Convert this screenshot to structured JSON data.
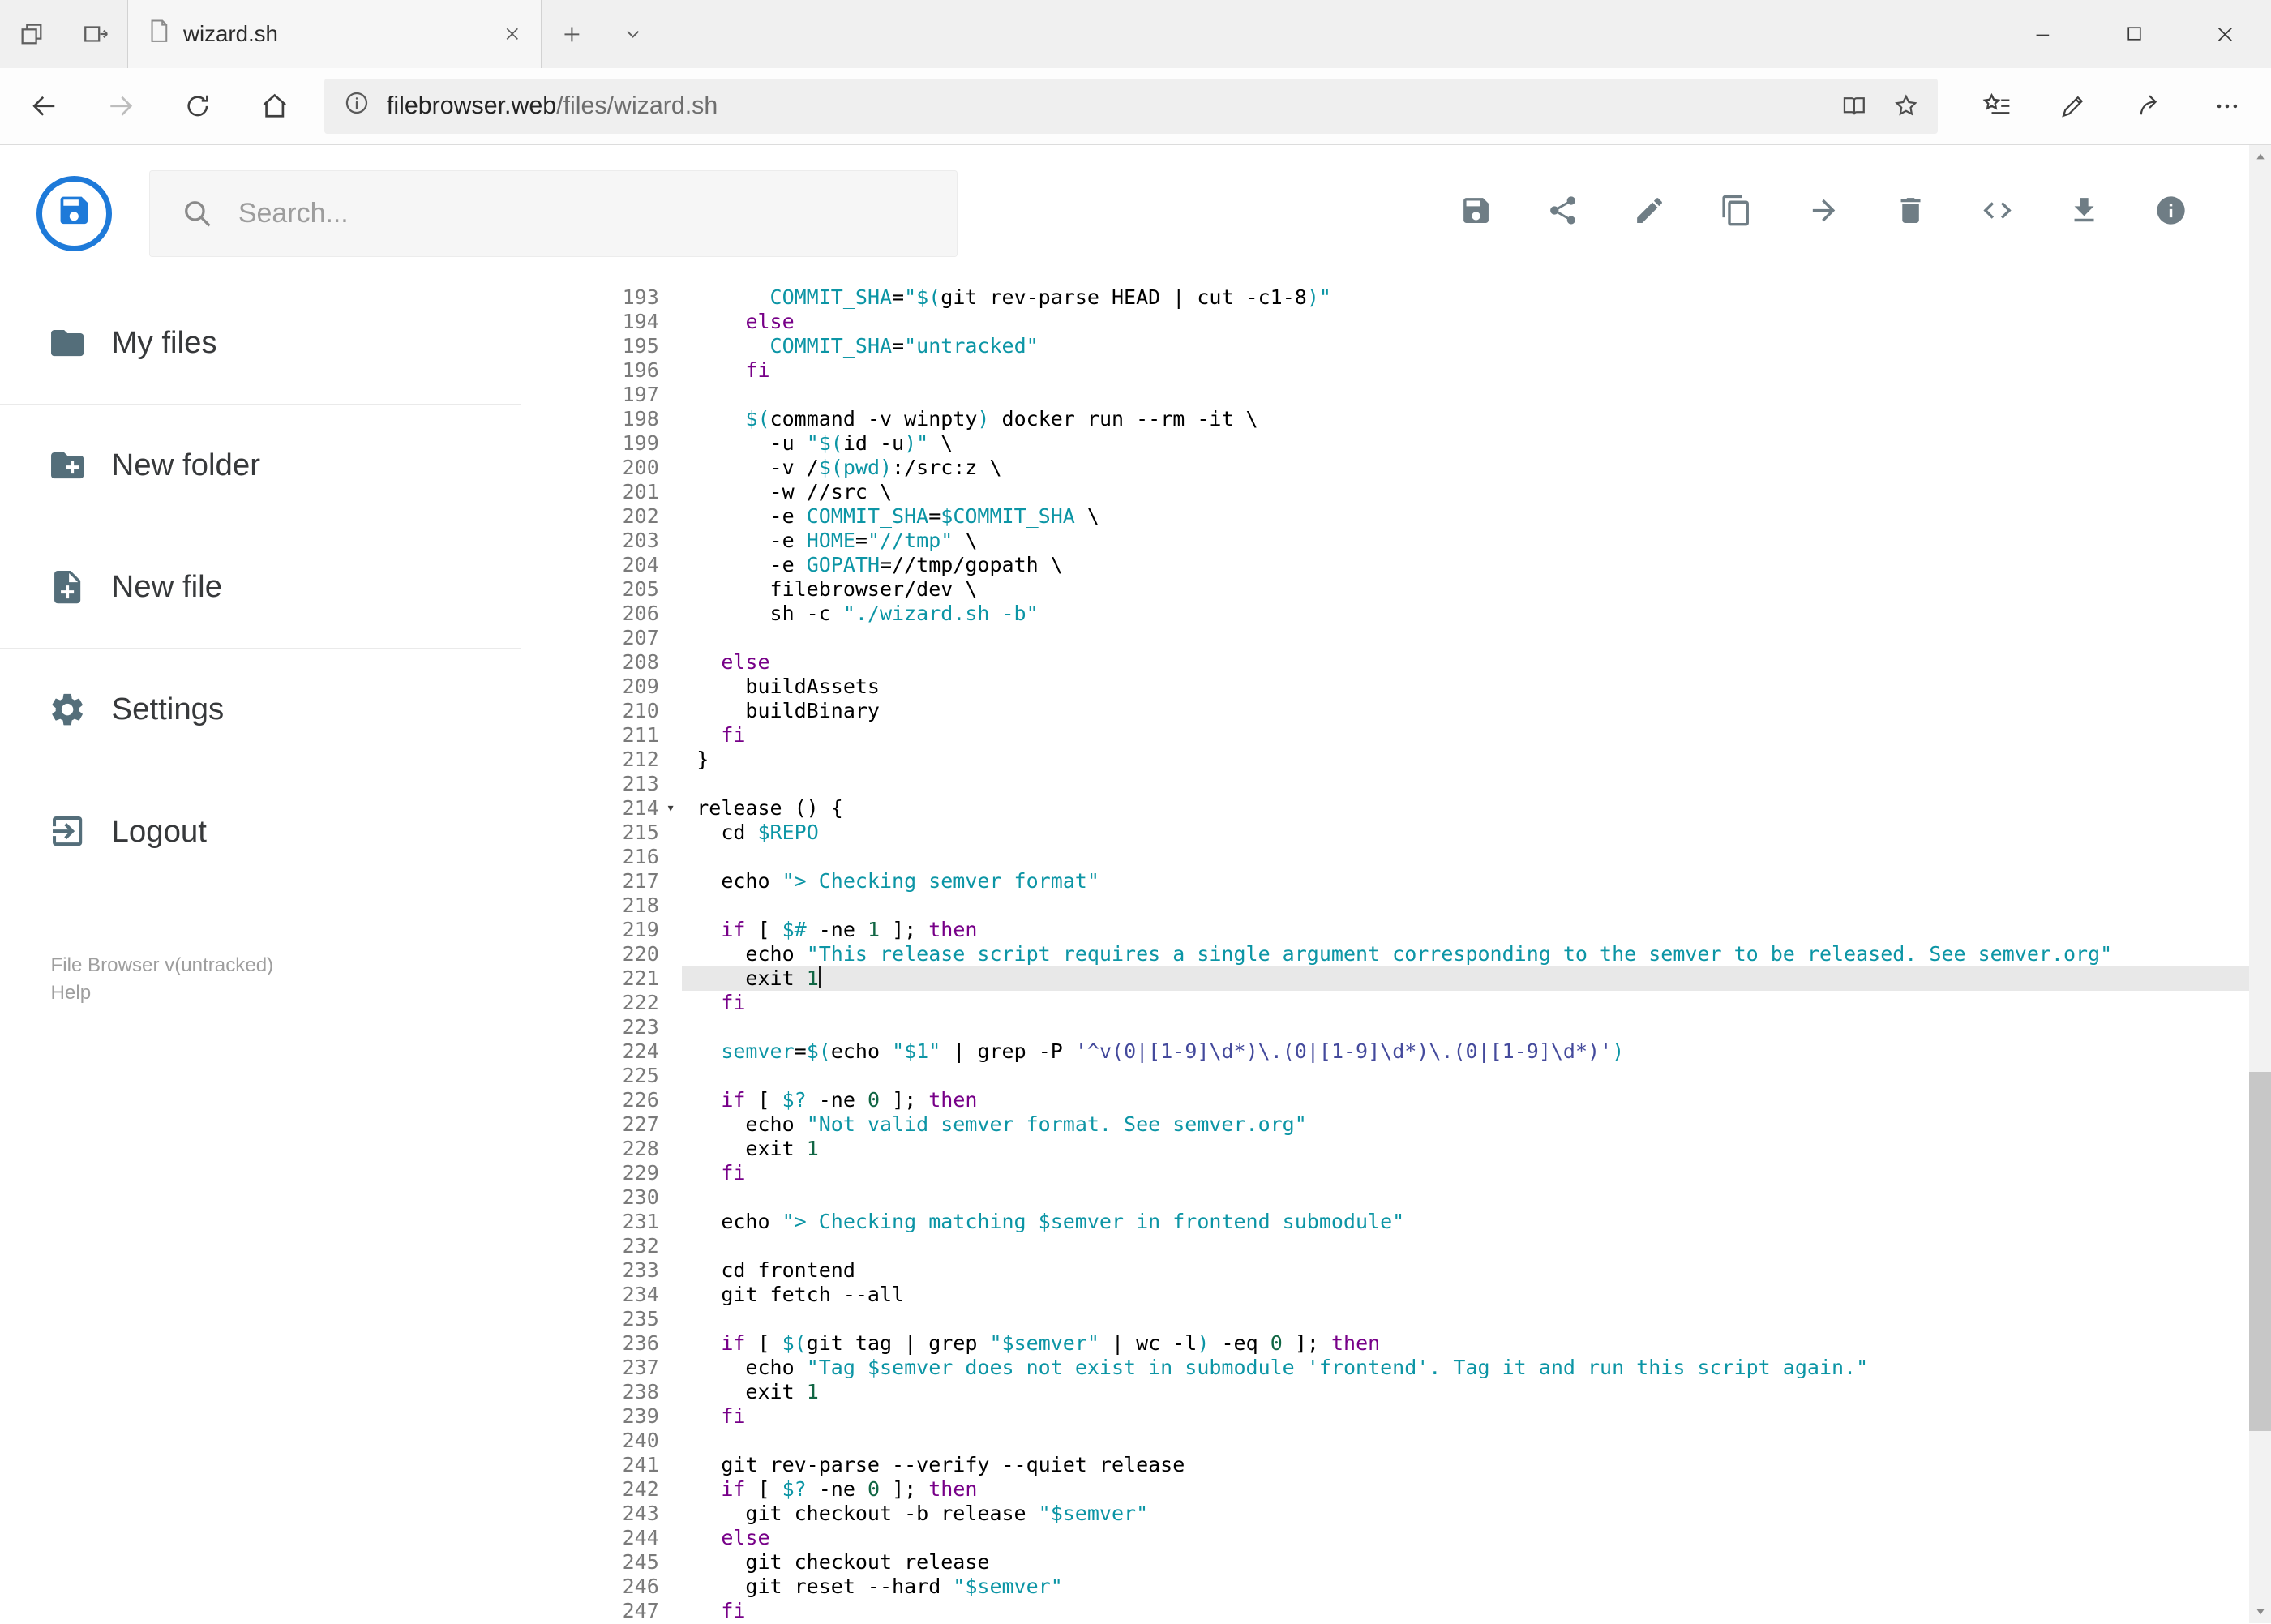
{
  "colors": {
    "accent": "#1e7ad9",
    "iconGray": "#6f7d85",
    "sidebarIcon": "#546e7a",
    "keyword": "#770088",
    "string": "#0c95a5",
    "string2": "#444a9c",
    "variable": "#0c95a5",
    "definition": "#0c95a5",
    "number": "#116644",
    "codeText": "#000000",
    "activeLine": "#e8e8e8",
    "lineNumber": "#7a7a7a"
  },
  "browser": {
    "tab_title": "wizard.sh",
    "url_host": "filebrowser.web",
    "url_path": "/files/wizard.sh",
    "icons": [
      "set-tabs-aside-icon",
      "tabs-set-aside-icon",
      "page-icon",
      "tab-close-icon",
      "new-tab-icon",
      "tab-preview-chevron-icon",
      "minimize-icon",
      "maximize-icon",
      "close-icon",
      "back-icon",
      "forward-icon",
      "refresh-icon",
      "home-icon",
      "site-info-icon",
      "reading-view-icon",
      "favorite-star-icon",
      "hub-icon",
      "web-note-pen-icon",
      "share-icon",
      "ellipsis-icon"
    ]
  },
  "header": {
    "search_placeholder": "Search...",
    "logo_icon": "logo-floppy-icon",
    "search_icon": "search-icon",
    "toolbar": [
      {
        "icon": "save-icon"
      },
      {
        "icon": "share-icon"
      },
      {
        "icon": "edit-icon"
      },
      {
        "icon": "copy-icon"
      },
      {
        "icon": "move-icon"
      },
      {
        "icon": "delete-icon"
      },
      {
        "icon": "code-icon"
      },
      {
        "icon": "download-icon"
      },
      {
        "icon": "info-icon"
      }
    ]
  },
  "sidebar": {
    "items": [
      {
        "icon": "folder-icon",
        "label": "My files",
        "divider_after": true
      },
      {
        "icon": "new-folder-icon",
        "label": "New folder"
      },
      {
        "icon": "new-file-icon",
        "label": "New file",
        "divider_after": true
      },
      {
        "icon": "settings-icon",
        "label": "Settings"
      },
      {
        "icon": "logout-icon",
        "label": "Logout"
      }
    ],
    "footer_version": "File Browser v(untracked)",
    "footer_help": "Help"
  },
  "editor": {
    "active_line": 221,
    "cursor_line": 221,
    "fold_lines": [
      214
    ],
    "fold_glyph": "▾",
    "lines": [
      {
        "n": 193,
        "t": [
          [
            "t",
            "      "
          ],
          [
            "d",
            "COMMIT_SHA"
          ],
          [
            "t",
            "="
          ],
          [
            "s",
            "\"$("
          ],
          [
            "t",
            "git rev-parse HEAD | cut -c1-8"
          ],
          [
            "s",
            ")\""
          ]
        ]
      },
      {
        "n": 194,
        "t": [
          [
            "t",
            "    "
          ],
          [
            "k",
            "else"
          ]
        ]
      },
      {
        "n": 195,
        "t": [
          [
            "t",
            "      "
          ],
          [
            "d",
            "COMMIT_SHA"
          ],
          [
            "t",
            "="
          ],
          [
            "s",
            "\"untracked\""
          ]
        ]
      },
      {
        "n": 196,
        "t": [
          [
            "t",
            "    "
          ],
          [
            "k",
            "fi"
          ]
        ]
      },
      {
        "n": 197,
        "t": []
      },
      {
        "n": 198,
        "t": [
          [
            "t",
            "    "
          ],
          [
            "v",
            "$("
          ],
          [
            "t",
            "command -v winpty"
          ],
          [
            "v",
            ")"
          ],
          [
            "t",
            " docker run --rm -it \\"
          ]
        ]
      },
      {
        "n": 199,
        "t": [
          [
            "t",
            "      -u "
          ],
          [
            "s",
            "\"$("
          ],
          [
            "t",
            "id -u"
          ],
          [
            "s",
            ")\""
          ],
          [
            "t",
            " \\"
          ]
        ]
      },
      {
        "n": 200,
        "t": [
          [
            "t",
            "      -v /"
          ],
          [
            "v",
            "$(pwd)"
          ],
          [
            "t",
            ":/src:z \\"
          ]
        ]
      },
      {
        "n": 201,
        "t": [
          [
            "t",
            "      -w //src \\"
          ]
        ]
      },
      {
        "n": 202,
        "t": [
          [
            "t",
            "      -e "
          ],
          [
            "d",
            "COMMIT_SHA"
          ],
          [
            "t",
            "="
          ],
          [
            "v",
            "$COMMIT_SHA"
          ],
          [
            "t",
            " \\"
          ]
        ]
      },
      {
        "n": 203,
        "t": [
          [
            "t",
            "      -e "
          ],
          [
            "d",
            "HOME"
          ],
          [
            "t",
            "="
          ],
          [
            "s",
            "\"//tmp\""
          ],
          [
            "t",
            " \\"
          ]
        ]
      },
      {
        "n": 204,
        "t": [
          [
            "t",
            "      -e "
          ],
          [
            "d",
            "GOPATH"
          ],
          [
            "t",
            "=//tmp/gopath \\"
          ]
        ]
      },
      {
        "n": 205,
        "t": [
          [
            "t",
            "      filebrowser/dev \\"
          ]
        ]
      },
      {
        "n": 206,
        "t": [
          [
            "t",
            "      sh -c "
          ],
          [
            "s",
            "\"./wizard.sh -b\""
          ]
        ]
      },
      {
        "n": 207,
        "t": []
      },
      {
        "n": 208,
        "t": [
          [
            "t",
            "  "
          ],
          [
            "k",
            "else"
          ]
        ]
      },
      {
        "n": 209,
        "t": [
          [
            "t",
            "    buildAssets"
          ]
        ]
      },
      {
        "n": 210,
        "t": [
          [
            "t",
            "    buildBinary"
          ]
        ]
      },
      {
        "n": 211,
        "t": [
          [
            "t",
            "  "
          ],
          [
            "k",
            "fi"
          ]
        ]
      },
      {
        "n": 212,
        "t": [
          [
            "t",
            "}"
          ]
        ]
      },
      {
        "n": 213,
        "t": []
      },
      {
        "n": 214,
        "t": [
          [
            "t",
            "release () {"
          ]
        ]
      },
      {
        "n": 215,
        "t": [
          [
            "t",
            "  cd "
          ],
          [
            "v",
            "$REPO"
          ]
        ]
      },
      {
        "n": 216,
        "t": []
      },
      {
        "n": 217,
        "t": [
          [
            "t",
            "  echo "
          ],
          [
            "s",
            "\"> Checking semver format\""
          ]
        ]
      },
      {
        "n": 218,
        "t": []
      },
      {
        "n": 219,
        "t": [
          [
            "t",
            "  "
          ],
          [
            "k",
            "if"
          ],
          [
            "t",
            " [ "
          ],
          [
            "v",
            "$#"
          ],
          [
            "t",
            " -ne "
          ],
          [
            "n2",
            ""
          ],
          [
            "n",
            "1"
          ],
          [
            "t",
            " ]; "
          ],
          [
            "k",
            "then"
          ]
        ]
      },
      {
        "n": 220,
        "t": [
          [
            "t",
            "    echo "
          ],
          [
            "s",
            "\"This release script requires a single argument corresponding to the semver to be released. See semver.org\""
          ]
        ]
      },
      {
        "n": 221,
        "t": [
          [
            "t",
            "    exit "
          ],
          [
            "n",
            "1"
          ]
        ]
      },
      {
        "n": 222,
        "t": [
          [
            "t",
            "  "
          ],
          [
            "k",
            "fi"
          ]
        ]
      },
      {
        "n": 223,
        "t": []
      },
      {
        "n": 224,
        "t": [
          [
            "t",
            "  "
          ],
          [
            "d",
            "semver"
          ],
          [
            "t",
            "="
          ],
          [
            "v",
            "$("
          ],
          [
            "t",
            "echo "
          ],
          [
            "s",
            "\"$1\""
          ],
          [
            "t",
            " | grep -P "
          ],
          [
            "s2",
            "'^v(0|[1-9]\\d*)\\.(0|[1-9]\\d*)\\.(0|[1-9]\\d*)'"
          ],
          [
            "v",
            ")"
          ]
        ]
      },
      {
        "n": 225,
        "t": []
      },
      {
        "n": 226,
        "t": [
          [
            "t",
            "  "
          ],
          [
            "k",
            "if"
          ],
          [
            "t",
            " [ "
          ],
          [
            "v",
            "$?"
          ],
          [
            "t",
            " -ne "
          ],
          [
            "n",
            "0"
          ],
          [
            "t",
            " ]; "
          ],
          [
            "k",
            "then"
          ]
        ]
      },
      {
        "n": 227,
        "t": [
          [
            "t",
            "    echo "
          ],
          [
            "s",
            "\"Not valid semver format. See semver.org\""
          ]
        ]
      },
      {
        "n": 228,
        "t": [
          [
            "t",
            "    exit "
          ],
          [
            "n",
            "1"
          ]
        ]
      },
      {
        "n": 229,
        "t": [
          [
            "t",
            "  "
          ],
          [
            "k",
            "fi"
          ]
        ]
      },
      {
        "n": 230,
        "t": []
      },
      {
        "n": 231,
        "t": [
          [
            "t",
            "  echo "
          ],
          [
            "s",
            "\"> Checking matching $semver in frontend submodule\""
          ]
        ]
      },
      {
        "n": 232,
        "t": []
      },
      {
        "n": 233,
        "t": [
          [
            "t",
            "  cd frontend"
          ]
        ]
      },
      {
        "n": 234,
        "t": [
          [
            "t",
            "  git fetch --all"
          ]
        ]
      },
      {
        "n": 235,
        "t": []
      },
      {
        "n": 236,
        "t": [
          [
            "t",
            "  "
          ],
          [
            "k",
            "if"
          ],
          [
            "t",
            " [ "
          ],
          [
            "v",
            "$("
          ],
          [
            "t",
            "git tag | grep "
          ],
          [
            "s",
            "\"$semver\""
          ],
          [
            "t",
            " | wc -l"
          ],
          [
            "v",
            ")"
          ],
          [
            "t",
            " -eq "
          ],
          [
            "n",
            "0"
          ],
          [
            "t",
            " ]; "
          ],
          [
            "k",
            "then"
          ]
        ]
      },
      {
        "n": 237,
        "t": [
          [
            "t",
            "    echo "
          ],
          [
            "s",
            "\"Tag $semver does not exist in submodule 'frontend'. Tag it and run this script again.\""
          ]
        ]
      },
      {
        "n": 238,
        "t": [
          [
            "t",
            "    exit "
          ],
          [
            "n",
            "1"
          ]
        ]
      },
      {
        "n": 239,
        "t": [
          [
            "t",
            "  "
          ],
          [
            "k",
            "fi"
          ]
        ]
      },
      {
        "n": 240,
        "t": []
      },
      {
        "n": 241,
        "t": [
          [
            "t",
            "  git rev-parse --verify --quiet release"
          ]
        ]
      },
      {
        "n": 242,
        "t": [
          [
            "t",
            "  "
          ],
          [
            "k",
            "if"
          ],
          [
            "t",
            " [ "
          ],
          [
            "v",
            "$?"
          ],
          [
            "t",
            " -ne "
          ],
          [
            "n",
            "0"
          ],
          [
            "t",
            " ]; "
          ],
          [
            "k",
            "then"
          ]
        ]
      },
      {
        "n": 243,
        "t": [
          [
            "t",
            "    git checkout -b release "
          ],
          [
            "s",
            "\"$semver\""
          ]
        ]
      },
      {
        "n": 244,
        "t": [
          [
            "t",
            "  "
          ],
          [
            "k",
            "else"
          ]
        ]
      },
      {
        "n": 245,
        "t": [
          [
            "t",
            "    git checkout release"
          ]
        ]
      },
      {
        "n": 246,
        "t": [
          [
            "t",
            "    git reset --hard "
          ],
          [
            "s",
            "\"$semver\""
          ]
        ]
      },
      {
        "n": 247,
        "t": [
          [
            "t",
            "  "
          ],
          [
            "k",
            "fi"
          ]
        ]
      }
    ]
  }
}
